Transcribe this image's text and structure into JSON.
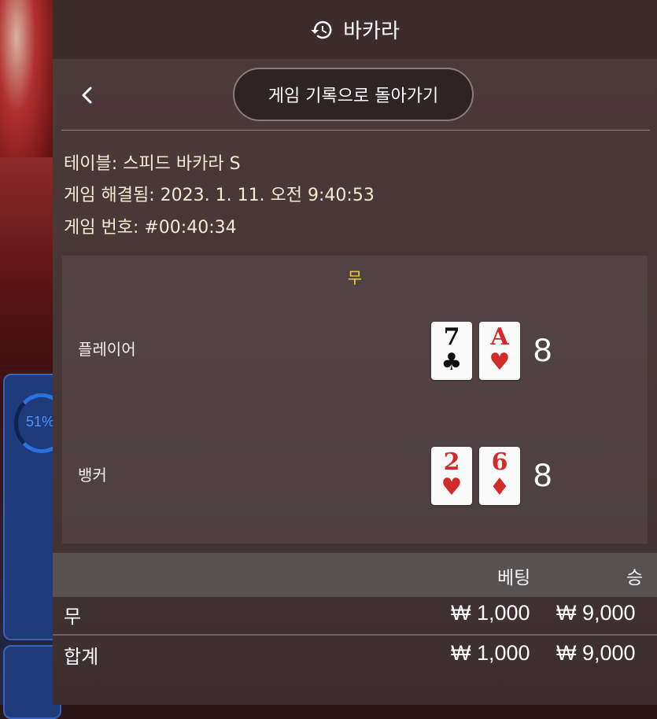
{
  "header": {
    "title": "바카라",
    "icon": "history-icon"
  },
  "nav": {
    "back_label": "게임 기록으로 돌아가기"
  },
  "info": {
    "table_label": "테이블:",
    "table_value": "스피드 바카라 S",
    "resolved_label": "게임 해결됨:",
    "resolved_value": "2023. 1. 11. 오전 9:40:53",
    "number_label": "게임 번호:",
    "number_value": "#00:40:34"
  },
  "result": {
    "outcome": "무",
    "player": {
      "label": "플레이어",
      "cards": [
        {
          "rank": "7",
          "suit": "♣",
          "color": "black"
        },
        {
          "rank": "A",
          "suit": "♥",
          "color": "red"
        }
      ],
      "score": "8"
    },
    "banker": {
      "label": "뱅커",
      "cards": [
        {
          "rank": "2",
          "suit": "♥",
          "color": "red"
        },
        {
          "rank": "6",
          "suit": "♦",
          "color": "red"
        }
      ],
      "score": "8"
    }
  },
  "bets": {
    "col_bet": "베팅",
    "col_win": "승",
    "rows": [
      {
        "label": "무",
        "bet": "₩ 1,000",
        "win": "₩ 9,000"
      },
      {
        "label": "합계",
        "bet": "₩ 1,000",
        "win": "₩ 9,000"
      }
    ]
  },
  "background": {
    "win_percent": "51%"
  },
  "colors": {
    "outcome_tie": "#f0d23a",
    "card_red": "#d22b2b",
    "accent_blue": "#2b6fe0"
  }
}
